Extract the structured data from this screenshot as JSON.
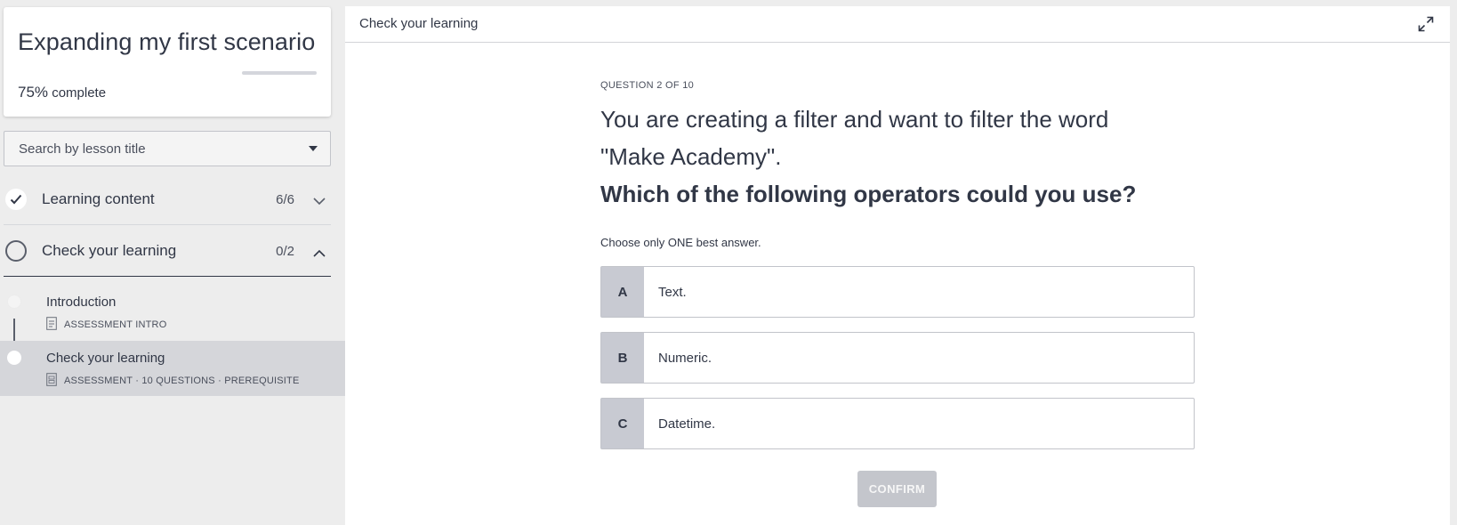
{
  "course": {
    "title": "Expanding my first scenario",
    "progress_percent": "75%",
    "progress_suffix": "complete",
    "progress_bar_fraction": 1.0
  },
  "search": {
    "placeholder": "Search by lesson title"
  },
  "sections": [
    {
      "title": "Learning content",
      "count": "6/6",
      "state": "completed",
      "expanded": false
    },
    {
      "title": "Check your learning",
      "count": "0/2",
      "state": "in-progress",
      "expanded": true
    }
  ],
  "lessons": [
    {
      "title": "Introduction",
      "meta": "ASSESSMENT INTRO",
      "selected": false
    },
    {
      "title": "Check your learning",
      "meta": "ASSESSMENT · 10 QUESTIONS · PREREQUISITE",
      "selected": true
    }
  ],
  "main": {
    "header_title": "Check your learning",
    "question_counter": "QUESTION 2 OF 10",
    "question_line1": "You are creating a filter and want to filter the word",
    "question_line2": "\"Make Academy\".",
    "question_bold": "Which of the following operators could you use?",
    "instruction": "Choose only ONE best answer.",
    "options": [
      {
        "letter": "A",
        "text": "Text."
      },
      {
        "letter": "B",
        "text": "Numeric."
      },
      {
        "letter": "C",
        "text": "Datetime."
      }
    ],
    "confirm_label": "CONFIRM"
  },
  "colors": {
    "text": "#313746",
    "option_letter_bg": "#c8cad2",
    "selected_lesson_bg": "#d5d6da",
    "confirm_disabled_bg": "#c4c6cc",
    "page_bg": "#ededed"
  },
  "icons": [
    "checkmark-icon",
    "chevron-down-icon",
    "chevron-up-icon",
    "document-icon",
    "assessment-icon",
    "expand-icon",
    "caret-down-icon"
  ]
}
